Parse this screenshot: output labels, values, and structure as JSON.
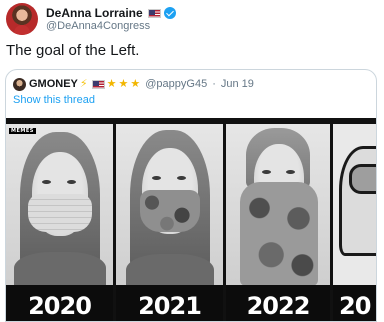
{
  "tweet": {
    "author": {
      "display_name": "DeAnna Lorraine",
      "handle": "@DeAnna4Congress",
      "flag_icon": "us-flag-icon",
      "verified_icon": "verified-badge-icon"
    },
    "text": "The goal of the Left."
  },
  "quoted_tweet": {
    "author": {
      "display_name": "GMONEY",
      "badges": [
        "lightning-icon",
        "us-flag-icon",
        "star-icon",
        "star-icon",
        "star-icon"
      ],
      "handle": "@pappyG45",
      "date": "Jun 19"
    },
    "separator": "·",
    "show_thread_label": "Show this thread",
    "image": {
      "logo_tag": "MEMES",
      "panels": [
        {
          "year": "2020",
          "mask": "surgical-mask"
        },
        {
          "year": "2021",
          "mask": "camo-mask"
        },
        {
          "year": "2022",
          "mask": "neck-gaiter"
        },
        {
          "year": "20",
          "mask": "among-us-astronaut"
        }
      ]
    }
  },
  "colors": {
    "link_blue": "#1da1f2",
    "secondary_text": "#657786",
    "verified_blue": "#1da1f2",
    "border": "#ccd6dd"
  }
}
